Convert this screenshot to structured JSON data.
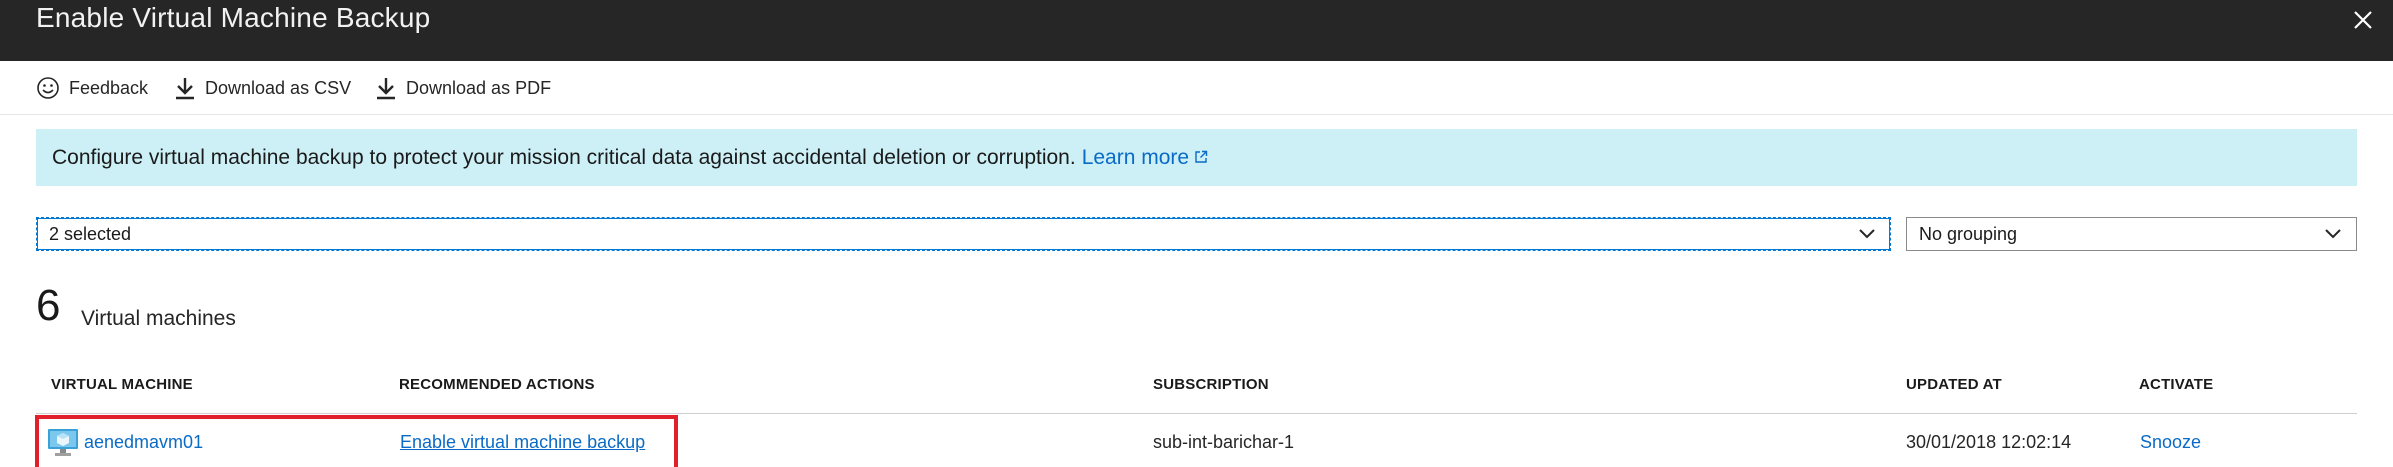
{
  "window": {
    "title": "Enable Virtual Machine Backup"
  },
  "toolbar": {
    "feedback_label": "Feedback",
    "csv_label": "Download as CSV",
    "pdf_label": "Download as PDF"
  },
  "banner": {
    "text": "Configure virtual machine backup to protect your mission critical data against accidental deletion or corruption.",
    "link": "Learn more"
  },
  "filters": {
    "subscriptions_value": "2 selected",
    "grouping_value": "No grouping"
  },
  "summary": {
    "count": "6",
    "label": "Virtual machines"
  },
  "table": {
    "columns": [
      "VIRTUAL MACHINE",
      "RECOMMENDED ACTIONS",
      "SUBSCRIPTION",
      "UPDATED AT",
      "ACTIVATE"
    ],
    "rows": [
      {
        "vm": "aenedmavm01",
        "action": "Enable virtual machine backup",
        "subscription": "sub-int-barichar-1",
        "updated": "30/01/2018 12:02:14",
        "activate": "Snooze"
      }
    ]
  },
  "colors": {
    "titlebar": "#262626",
    "banner_bg": "#cdf0f7",
    "link": "#0a6bc6",
    "highlight": "#e0202a",
    "focus": "#0078d4"
  },
  "icons": [
    "close-icon",
    "smiley-icon",
    "download-icon",
    "external-link-icon",
    "chevron-down-icon",
    "virtual-machine-icon"
  ]
}
